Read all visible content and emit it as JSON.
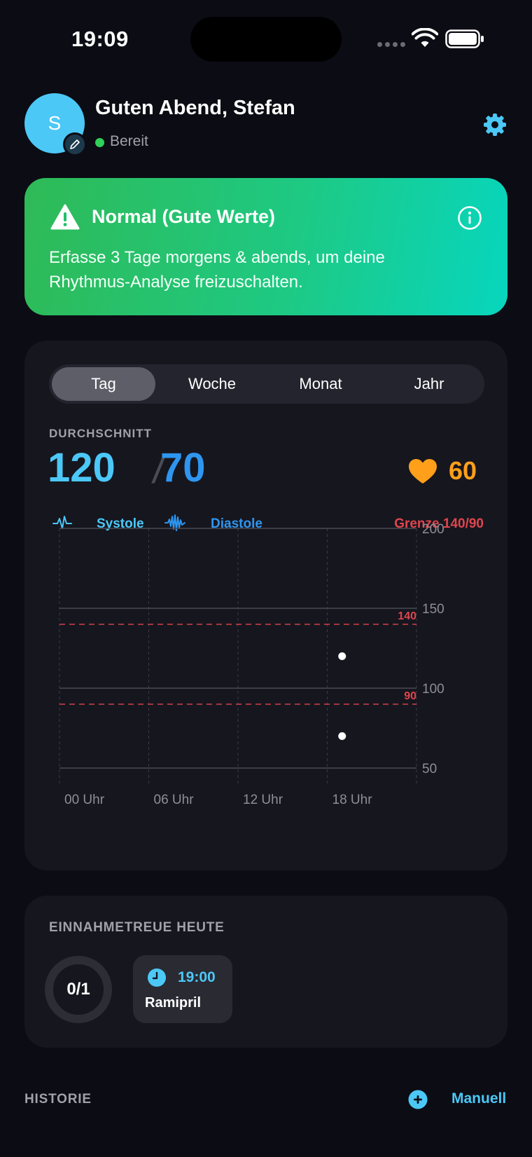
{
  "status_bar": {
    "time": "19:09"
  },
  "header": {
    "avatar_letter": "S",
    "greeting": "Guten Abend, Stefan",
    "status": "Bereit"
  },
  "alert": {
    "title": "Normal (Gute Werte)",
    "text": "Erfasse 3 Tage morgens & abends, um deine Rhythmus-Analyse freizuschalten.",
    "gradient_colors": [
      "#2fba56",
      "#07d6be"
    ]
  },
  "tabs": [
    "Tag",
    "Woche",
    "Monat",
    "Jahr"
  ],
  "active_tab": "Tag",
  "average": {
    "label": "DURCHSCHNITT",
    "systolic": "120",
    "slash": "/",
    "diastolic": "70",
    "pulse": "60"
  },
  "legend": {
    "systolic": "Systole",
    "diastolic": "Diastole",
    "limit": "Grenze 140/90"
  },
  "colors": {
    "systolic": "#4cc8f7",
    "diastolic": "#2e96f0",
    "limit": "#e0454c",
    "pulse": "#ff9f1a",
    "background": "#0c0c14",
    "card": "#16161f"
  },
  "chart_data": {
    "type": "scatter",
    "x_ticks": [
      "00 Uhr",
      "06 Uhr",
      "12 Uhr",
      "18 Uhr"
    ],
    "x_range_hours": [
      0,
      24
    ],
    "y_ticks": [
      200,
      150,
      100,
      50
    ],
    "ylim": [
      50,
      200
    ],
    "reference_lines": [
      {
        "label": "140",
        "value": 140
      },
      {
        "label": "90",
        "value": 90
      }
    ],
    "series": [
      {
        "name": "Systole",
        "points": [
          {
            "x": 19,
            "y": 120
          }
        ]
      },
      {
        "name": "Diastole",
        "points": [
          {
            "x": 19,
            "y": 70
          }
        ]
      }
    ]
  },
  "adherence": {
    "title": "EINNAHMETREUE HEUTE",
    "progress_label": "0/1",
    "progress": 0,
    "medication": {
      "time": "19:00",
      "name": "Ramipril"
    }
  },
  "history": {
    "title": "HISTORIE",
    "manual_label": "Manuell"
  }
}
